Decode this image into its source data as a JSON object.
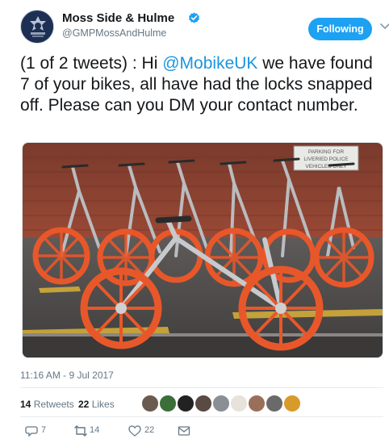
{
  "account": {
    "name": "Moss Side & Hulme",
    "handle": "@GMPMossAndHulme",
    "verified": true,
    "avatar_icon": "police-badge-avatar"
  },
  "follow_button": {
    "label": "Following",
    "color": "#1da1f2"
  },
  "menu_icon": "chevron-down-icon",
  "tweet": {
    "prefix": "(1 of 2 tweets) :  Hi ",
    "mention": "@MobikeUK",
    "body": " we have found 7 of your bikes, all have had the locks snapped off.  Please can you DM your contact number.",
    "mention_color": "#1b95e0"
  },
  "photo": {
    "sign_lines": [
      "PARKING FOR",
      "LIVERIED POLICE",
      "VEHICLES ONLY"
    ],
    "wheel_color": "#e8572a"
  },
  "timestamp": "11:16 AM - 9 Jul 2017",
  "stats": {
    "retweets_count": "14",
    "retweets_label": "Retweets",
    "likes_count": "22",
    "likes_label": "Likes",
    "liker_avatars": 9
  },
  "actions": {
    "reply_count": "7",
    "retweet_count": "14",
    "like_count": "22",
    "icons": [
      "reply-icon",
      "retweet-icon",
      "like-icon",
      "message-icon"
    ]
  }
}
